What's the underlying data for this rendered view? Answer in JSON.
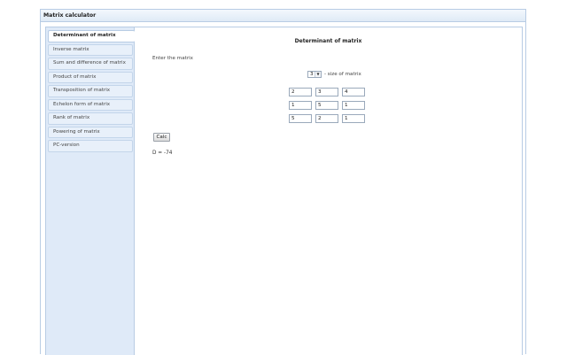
{
  "app": {
    "title": "Matrix calculator"
  },
  "sidebar": {
    "items": [
      {
        "label": "Determinant of matrix",
        "active": true
      },
      {
        "label": "Inverse matrix",
        "active": false
      },
      {
        "label": "Sum and difference of matrix",
        "active": false
      },
      {
        "label": "Product of matrix",
        "active": false
      },
      {
        "label": "Transposition of matrix",
        "active": false
      },
      {
        "label": "Echelon form of matrix",
        "active": false
      },
      {
        "label": "Rank of matrix",
        "active": false
      },
      {
        "label": "Powering of matrix",
        "active": false
      },
      {
        "label": "PC-version",
        "active": false
      }
    ]
  },
  "main": {
    "heading": "Determinant of matrix",
    "enter_label": "Enter the matrix",
    "size_select_value": "3",
    "size_label": "- size of matrix",
    "matrix": [
      [
        "2",
        "3",
        "4"
      ],
      [
        "1",
        "5",
        "1"
      ],
      [
        "5",
        "2",
        "1"
      ]
    ],
    "calc_label": "Calc",
    "result": "D = -74"
  },
  "colors": {
    "border": "#b8cce4",
    "sidebar_bg": "#dfeaf8"
  }
}
